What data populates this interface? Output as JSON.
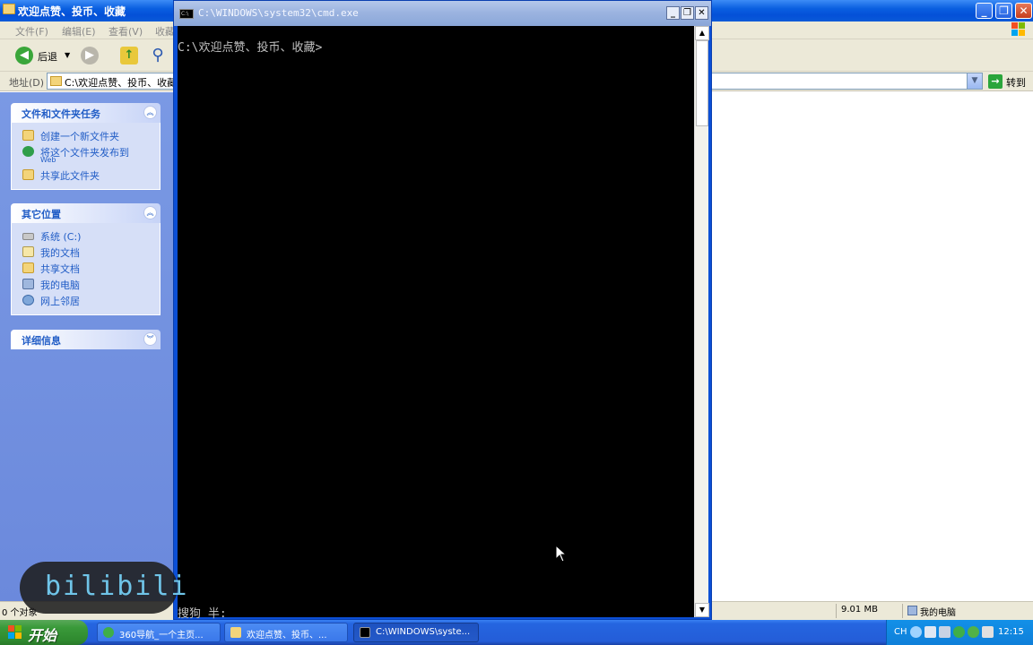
{
  "explorer": {
    "title": "欢迎点赞、投币、收藏",
    "menu": [
      "文件(F)",
      "编辑(E)",
      "查看(V)",
      "收藏"
    ],
    "toolbar": {
      "back_label": "后退"
    },
    "address": {
      "label": "地址(D)",
      "value": "C:\\欢迎点赞、投币、收藏",
      "go_label": "转到"
    },
    "panels": [
      {
        "title": "文件和文件夹任务",
        "items": [
          {
            "label": "创建一个新文件夹",
            "icon": "new-folder-icon"
          },
          {
            "label": "将这个文件夹发布到",
            "sublabel": "Web",
            "icon": "publish-web-icon"
          },
          {
            "label": "共享此文件夹",
            "icon": "share-folder-icon"
          }
        ]
      },
      {
        "title": "其它位置",
        "items": [
          {
            "label": "系统 (C:)",
            "icon": "drive-icon"
          },
          {
            "label": "我的文档",
            "icon": "my-documents-icon"
          },
          {
            "label": "共享文档",
            "icon": "shared-documents-icon"
          },
          {
            "label": "我的电脑",
            "icon": "my-computer-icon"
          },
          {
            "label": "网上邻居",
            "icon": "network-icon"
          }
        ]
      },
      {
        "title": "详细信息",
        "items": []
      }
    ],
    "status": {
      "objects": "0 个对象",
      "size": "9.01 MB",
      "location": "我的电脑"
    }
  },
  "cmd": {
    "title": "C:\\WINDOWS\\system32\\cmd.exe",
    "prompt": "C:\\欢迎点赞、投币、收藏>",
    "ime_status": "搜狗      半:"
  },
  "watermark": {
    "text": "bilibili"
  },
  "taskbar": {
    "start_label": "开始",
    "tasks": [
      {
        "label": "360导航_一个主页...",
        "icon": "browser-icon",
        "color": "#3fae49"
      },
      {
        "label": "欢迎点赞、投币、...",
        "icon": "folder-icon",
        "color": "#f3d47a"
      },
      {
        "label": "C:\\WINDOWS\\syste...",
        "icon": "cmd-icon",
        "color": "#000000"
      }
    ],
    "tray": {
      "lang": "CH",
      "time": "12:15"
    }
  },
  "colors": {
    "xp_blue": "#0a5fe0",
    "task_text": "#215dc6",
    "console_bg": "#000000",
    "start_green": "#3a9a3a"
  }
}
